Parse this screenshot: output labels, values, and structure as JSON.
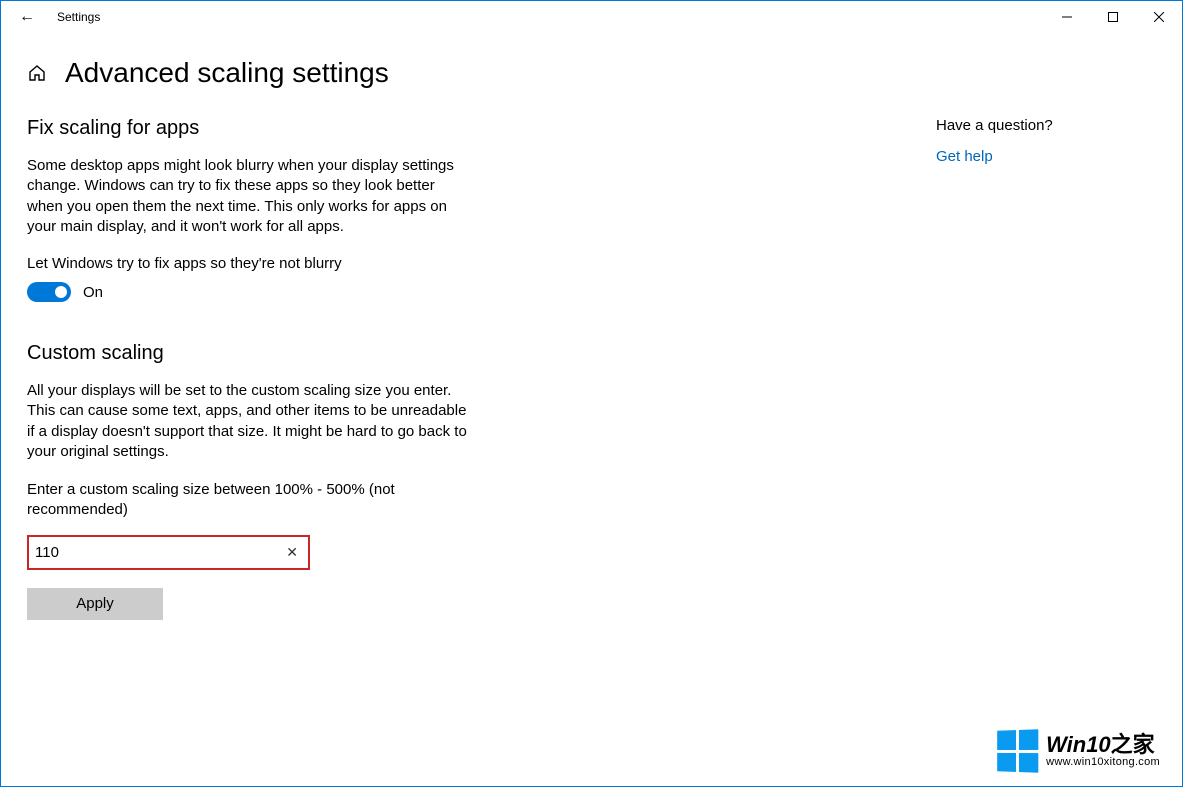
{
  "titlebar": {
    "title": "Settings"
  },
  "header": {
    "page_title": "Advanced scaling settings"
  },
  "fix_scaling": {
    "heading": "Fix scaling for apps",
    "description": "Some desktop apps might look blurry when your display settings change. Windows can try to fix these apps so they look better when you open them the next time. This only works for apps on your main display, and it won't work for all apps.",
    "toggle_label": "Let Windows try to fix apps so they're not blurry",
    "toggle_state": "On"
  },
  "custom_scaling": {
    "heading": "Custom scaling",
    "description": "All your displays will be set to the custom scaling size you enter. This can cause some text, apps, and other items to be unreadable if a display doesn't support that size. It might be hard to go back to your original settings.",
    "input_label": "Enter a custom scaling size between 100% - 500% (not recommended)",
    "input_value": "110",
    "apply_label": "Apply"
  },
  "sidebar": {
    "question": "Have a question?",
    "help_link": "Get help"
  },
  "watermark": {
    "brand": "Win10",
    "brand_suffix": "之家",
    "url": "www.win10xitong.com"
  }
}
